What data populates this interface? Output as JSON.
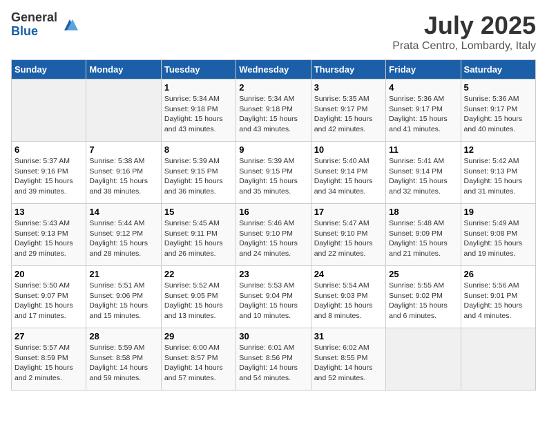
{
  "logo": {
    "general": "General",
    "blue": "Blue"
  },
  "title": "July 2025",
  "subtitle": "Prata Centro, Lombardy, Italy",
  "days_header": [
    "Sunday",
    "Monday",
    "Tuesday",
    "Wednesday",
    "Thursday",
    "Friday",
    "Saturday"
  ],
  "weeks": [
    [
      {
        "day": "",
        "info": ""
      },
      {
        "day": "",
        "info": ""
      },
      {
        "day": "1",
        "info": "Sunrise: 5:34 AM\nSunset: 9:18 PM\nDaylight: 15 hours and 43 minutes."
      },
      {
        "day": "2",
        "info": "Sunrise: 5:34 AM\nSunset: 9:18 PM\nDaylight: 15 hours and 43 minutes."
      },
      {
        "day": "3",
        "info": "Sunrise: 5:35 AM\nSunset: 9:17 PM\nDaylight: 15 hours and 42 minutes."
      },
      {
        "day": "4",
        "info": "Sunrise: 5:36 AM\nSunset: 9:17 PM\nDaylight: 15 hours and 41 minutes."
      },
      {
        "day": "5",
        "info": "Sunrise: 5:36 AM\nSunset: 9:17 PM\nDaylight: 15 hours and 40 minutes."
      }
    ],
    [
      {
        "day": "6",
        "info": "Sunrise: 5:37 AM\nSunset: 9:16 PM\nDaylight: 15 hours and 39 minutes."
      },
      {
        "day": "7",
        "info": "Sunrise: 5:38 AM\nSunset: 9:16 PM\nDaylight: 15 hours and 38 minutes."
      },
      {
        "day": "8",
        "info": "Sunrise: 5:39 AM\nSunset: 9:15 PM\nDaylight: 15 hours and 36 minutes."
      },
      {
        "day": "9",
        "info": "Sunrise: 5:39 AM\nSunset: 9:15 PM\nDaylight: 15 hours and 35 minutes."
      },
      {
        "day": "10",
        "info": "Sunrise: 5:40 AM\nSunset: 9:14 PM\nDaylight: 15 hours and 34 minutes."
      },
      {
        "day": "11",
        "info": "Sunrise: 5:41 AM\nSunset: 9:14 PM\nDaylight: 15 hours and 32 minutes."
      },
      {
        "day": "12",
        "info": "Sunrise: 5:42 AM\nSunset: 9:13 PM\nDaylight: 15 hours and 31 minutes."
      }
    ],
    [
      {
        "day": "13",
        "info": "Sunrise: 5:43 AM\nSunset: 9:13 PM\nDaylight: 15 hours and 29 minutes."
      },
      {
        "day": "14",
        "info": "Sunrise: 5:44 AM\nSunset: 9:12 PM\nDaylight: 15 hours and 28 minutes."
      },
      {
        "day": "15",
        "info": "Sunrise: 5:45 AM\nSunset: 9:11 PM\nDaylight: 15 hours and 26 minutes."
      },
      {
        "day": "16",
        "info": "Sunrise: 5:46 AM\nSunset: 9:10 PM\nDaylight: 15 hours and 24 minutes."
      },
      {
        "day": "17",
        "info": "Sunrise: 5:47 AM\nSunset: 9:10 PM\nDaylight: 15 hours and 22 minutes."
      },
      {
        "day": "18",
        "info": "Sunrise: 5:48 AM\nSunset: 9:09 PM\nDaylight: 15 hours and 21 minutes."
      },
      {
        "day": "19",
        "info": "Sunrise: 5:49 AM\nSunset: 9:08 PM\nDaylight: 15 hours and 19 minutes."
      }
    ],
    [
      {
        "day": "20",
        "info": "Sunrise: 5:50 AM\nSunset: 9:07 PM\nDaylight: 15 hours and 17 minutes."
      },
      {
        "day": "21",
        "info": "Sunrise: 5:51 AM\nSunset: 9:06 PM\nDaylight: 15 hours and 15 minutes."
      },
      {
        "day": "22",
        "info": "Sunrise: 5:52 AM\nSunset: 9:05 PM\nDaylight: 15 hours and 13 minutes."
      },
      {
        "day": "23",
        "info": "Sunrise: 5:53 AM\nSunset: 9:04 PM\nDaylight: 15 hours and 10 minutes."
      },
      {
        "day": "24",
        "info": "Sunrise: 5:54 AM\nSunset: 9:03 PM\nDaylight: 15 hours and 8 minutes."
      },
      {
        "day": "25",
        "info": "Sunrise: 5:55 AM\nSunset: 9:02 PM\nDaylight: 15 hours and 6 minutes."
      },
      {
        "day": "26",
        "info": "Sunrise: 5:56 AM\nSunset: 9:01 PM\nDaylight: 15 hours and 4 minutes."
      }
    ],
    [
      {
        "day": "27",
        "info": "Sunrise: 5:57 AM\nSunset: 8:59 PM\nDaylight: 15 hours and 2 minutes."
      },
      {
        "day": "28",
        "info": "Sunrise: 5:59 AM\nSunset: 8:58 PM\nDaylight: 14 hours and 59 minutes."
      },
      {
        "day": "29",
        "info": "Sunrise: 6:00 AM\nSunset: 8:57 PM\nDaylight: 14 hours and 57 minutes."
      },
      {
        "day": "30",
        "info": "Sunrise: 6:01 AM\nSunset: 8:56 PM\nDaylight: 14 hours and 54 minutes."
      },
      {
        "day": "31",
        "info": "Sunrise: 6:02 AM\nSunset: 8:55 PM\nDaylight: 14 hours and 52 minutes."
      },
      {
        "day": "",
        "info": ""
      },
      {
        "day": "",
        "info": ""
      }
    ]
  ]
}
